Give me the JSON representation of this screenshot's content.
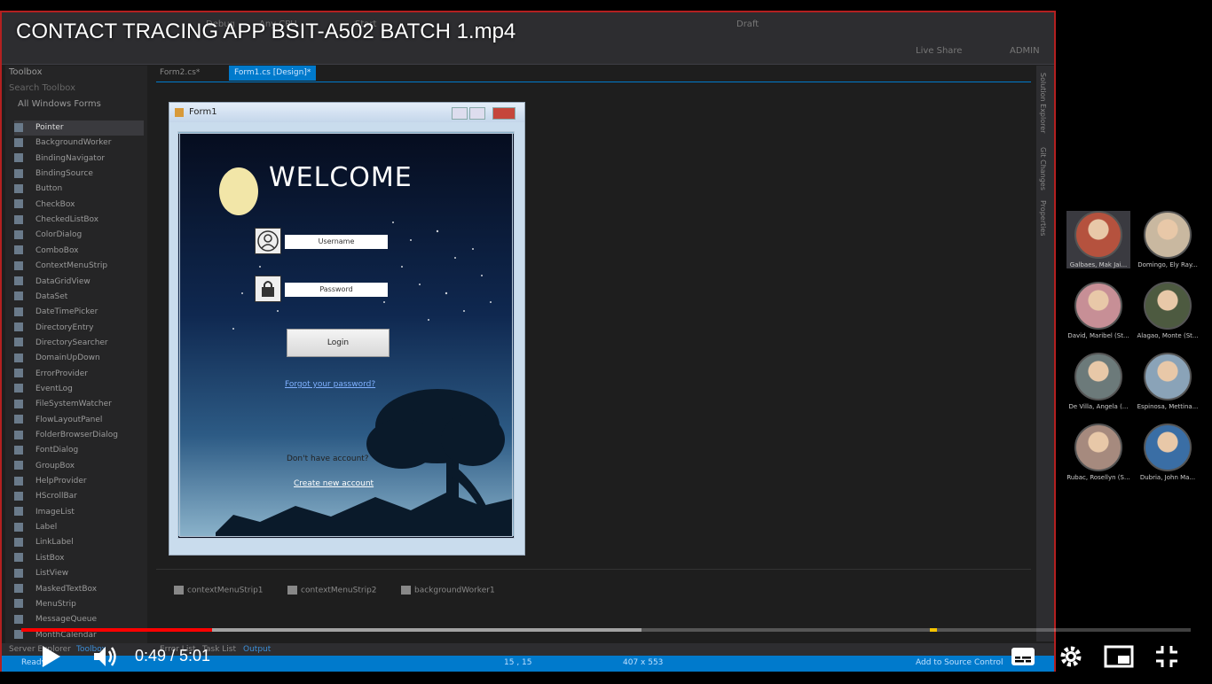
{
  "video": {
    "title": "CONTACT TRACING APP BSIT-A502 BATCH 1.mp4",
    "current_time": "0:49",
    "duration": "5:01",
    "time_display": "0:49 / 5:01",
    "played_fraction": 0.163,
    "buffered_fraction": 0.53
  },
  "ide": {
    "menu": [
      "Debug",
      "Any CPU",
      "Start",
      "Draft",
      "Live Share",
      "ADMIN"
    ],
    "toolbox_title": "Toolbox",
    "toolbox_search": "Search Toolbox",
    "toolbox_group": "All Windows Forms",
    "toolbox_items": [
      "Pointer",
      "BackgroundWorker",
      "BindingNavigator",
      "BindingSource",
      "Button",
      "CheckBox",
      "CheckedListBox",
      "ColorDialog",
      "ComboBox",
      "ContextMenuStrip",
      "DataGridView",
      "DataSet",
      "DateTimePicker",
      "DirectoryEntry",
      "DirectorySearcher",
      "DomainUpDown",
      "ErrorProvider",
      "EventLog",
      "FileSystemWatcher",
      "FlowLayoutPanel",
      "FolderBrowserDialog",
      "FontDialog",
      "GroupBox",
      "HelpProvider",
      "HScrollBar",
      "ImageList",
      "Label",
      "LinkLabel",
      "ListBox",
      "ListView",
      "MaskedTextBox",
      "MenuStrip",
      "MessageQueue",
      "MonthCalendar"
    ],
    "tabs": [
      "Form2.cs*",
      "Form1.cs [Design]*"
    ],
    "tray_components": [
      "contextMenuStrip1",
      "contextMenuStrip2",
      "backgroundWorker1"
    ],
    "right_dock": [
      "Solution Explorer",
      "Git Changes",
      "Properties"
    ],
    "bottom_dock": [
      "Server Explorer",
      "Toolbox",
      "Error List",
      "Task List",
      "Output"
    ],
    "status": {
      "ready": "Ready",
      "position": "15 , 15",
      "size": "407 x 553",
      "source_control": "Add to Source Control"
    }
  },
  "form": {
    "title": "Form1",
    "welcome": "WELCOME",
    "username_placeholder": "Username",
    "password_placeholder": "Password",
    "login_label": "Login",
    "forgot_label": "Forgot your password?",
    "no_account": "Don't have account?",
    "create_account": "Create new account"
  },
  "participants": [
    {
      "name": "Galbaes, Mak Jai...",
      "color": "#b5523e"
    },
    {
      "name": "Domingo, Ely Ray...",
      "color": "#c9b8a0"
    },
    {
      "name": "David, Maribel (St...",
      "color": "#c78f96"
    },
    {
      "name": "Alagao, Monte (St...",
      "color": "#4d5a40"
    },
    {
      "name": "De Villa, Angela (...",
      "color": "#6c7a7a"
    },
    {
      "name": "Espinosa, Mettina...",
      "color": "#8aa3b8"
    },
    {
      "name": "Rubac, Rosellyn (S...",
      "color": "#a68a7e"
    },
    {
      "name": "Dubria, John Ma...",
      "color": "#3a6ea5"
    }
  ]
}
